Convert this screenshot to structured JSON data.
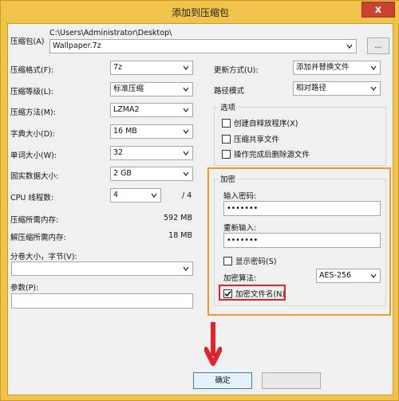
{
  "window": {
    "title": "添加到压缩包",
    "close_label": "x"
  },
  "archive": {
    "label": "压缩包(A)",
    "path": "C:\\Users\\Administrator\\Desktop\\",
    "filename": "Wallpaper.7z",
    "browse_label": "..."
  },
  "left": {
    "format": {
      "label": "压缩格式(F):",
      "value": "7z"
    },
    "level": {
      "label": "压缩等级(L):",
      "value": "标准压缩"
    },
    "method": {
      "label": "压缩方法(M):",
      "value": "LZMA2"
    },
    "dict": {
      "label": "字典大小(D):",
      "value": "16 MB"
    },
    "word": {
      "label": "单词大小(W):",
      "value": "32"
    },
    "solid": {
      "label": "固实数据大小:",
      "value": "2 GB"
    },
    "cpu": {
      "label": "CPU 线程数:",
      "value": "4",
      "total": "/ 4"
    },
    "mem_compress": {
      "label": "压缩所需内存:",
      "value": "592 MB"
    },
    "mem_decompress": {
      "label": "解压缩所需内存:",
      "value": "18 MB"
    },
    "split": {
      "label": "分卷大小，字节(V):",
      "value": ""
    },
    "params": {
      "label": "参数(P):",
      "value": ""
    }
  },
  "right": {
    "update": {
      "label": "更新方式(U):",
      "value": "添加并替换文件"
    },
    "pathmode": {
      "label": "路径模式",
      "value": "相对路径"
    },
    "options": {
      "title": "选项",
      "sfx": "创建自释放程序(X)",
      "shared": "压缩共享文件",
      "delete": "操作完成后删除源文件"
    },
    "encryption": {
      "title": "加密",
      "enter_label": "输入密码:",
      "enter_value": "•••••••",
      "reenter_label": "重新输入:",
      "reenter_value": "•••••••",
      "show_password": "显示密码(S)",
      "method_label": "加密算法:",
      "method_value": "AES-256",
      "encrypt_names": "加密文件名(N)"
    }
  },
  "buttons": {
    "ok": "确定"
  },
  "annotation_colors": {
    "orange": "#f09a2a",
    "red": "#e0232d"
  }
}
